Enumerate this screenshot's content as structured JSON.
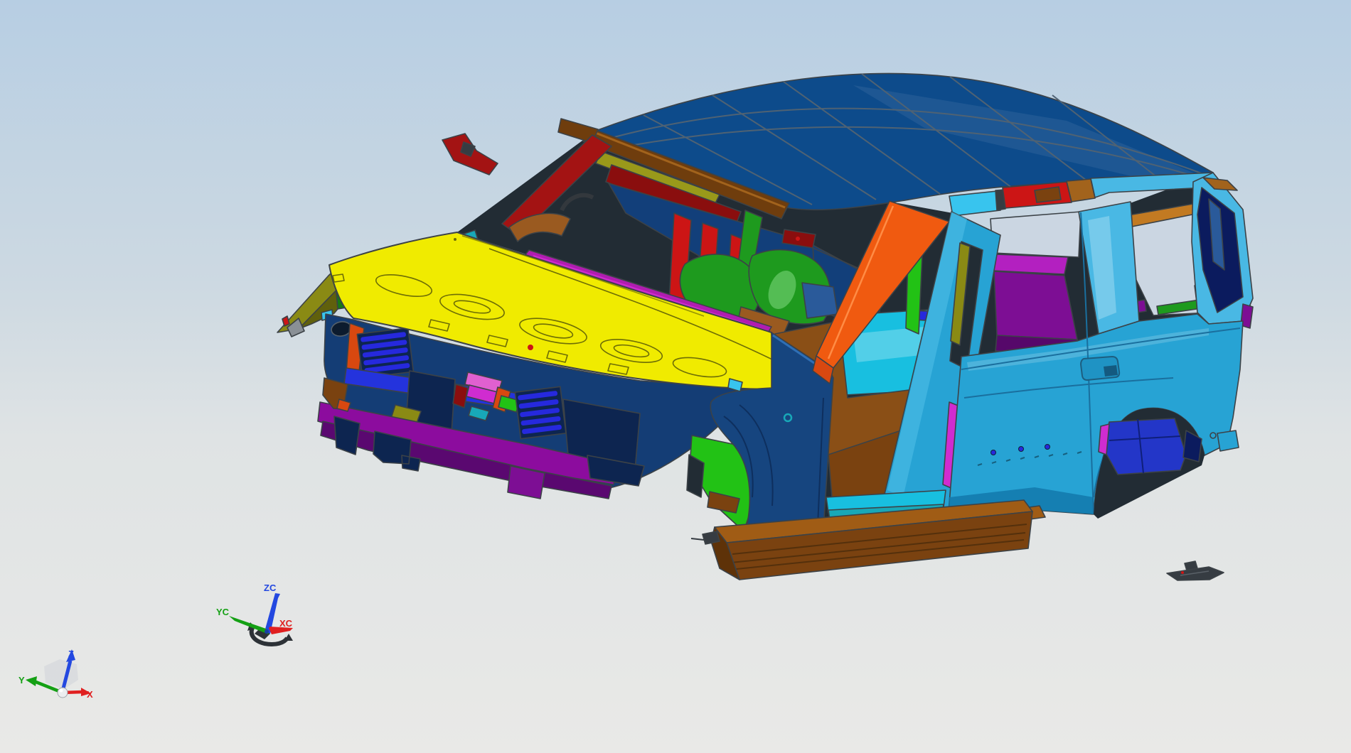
{
  "scene": {
    "type": "cad-3d-viewport",
    "content": "automotive body-in-white assembly, multi-colored sheet metal parts, isometric view"
  },
  "triads": {
    "wcs": {
      "x_label": "X",
      "y_label": "Y",
      "z_label": "Z",
      "x_color": "#e02020",
      "y_color": "#14a014",
      "z_color": "#2348e0",
      "cube_color": "#b468b4"
    },
    "csys": {
      "x_label": "XC",
      "y_label": "YC",
      "z_label": "ZC",
      "x_color": "#e02020",
      "y_color": "#14a014",
      "z_color": "#2348e0",
      "handle_color": "#2d3237"
    }
  },
  "colors": {
    "bg_top": "#b7cee3",
    "bg_mid": "#cdd9e2",
    "bg_low": "#dfe3e4",
    "bg_bottom": "#e9e9e7",
    "outline": "#3c4247",
    "interior_bg": "#222c34",
    "interior_navy": "#123f7a",
    "roof_blue": "#0d4b8b",
    "roof_seam": "#4f6273",
    "rail_brown": "#6f3d0d",
    "rail_brown_hi": "#a2631c",
    "apillar_red": "#a31313",
    "red": "#cc1515",
    "dk_red": "#8a0e0e",
    "copper": "#9a5a20",
    "hood_yellow": "#f0eb00",
    "hood_line": "#6d6d06",
    "olive": "#8a8a14",
    "olive_dark": "#60600c",
    "visor_olive": "#99991a",
    "fender_navy": "#16457f",
    "clip_navy": "#143d75",
    "navy_dark": "#0d2550",
    "grille_blue": "#2629dd",
    "blue_rail": "#2433dd",
    "steel_blue": "#2a5a9a",
    "bumper_purple": "#8c0c9e",
    "bumper_purple_dark": "#5a0870",
    "purple_rail": "#b320c0",
    "purple_panel": "#7d0e94",
    "purple_dark": "#56086a",
    "magenta": "#b01db0",
    "magenta_bright": "#d02cd0",
    "pink": "#e060d0",
    "orange": "#f05a10",
    "orange_deep": "#d84810",
    "tan_rail": "#c27a22",
    "body_blue": "#27a3d4",
    "body_blue_hi": "#55c4ea",
    "body_blue_dark": "#1379ab",
    "cpillar_blue": "#49b8e4",
    "cyan_strip": "#38c4ee",
    "cyan_floor": "#18bfe0",
    "teal": "#18a8b8",
    "bright_green": "#22c215",
    "seat_green": "#1e9a1e",
    "seat_green_dk": "#157a15",
    "floor_brown": "#8a4f16",
    "board_top": "#a05c15",
    "board_face": "#7a4210",
    "wheel_blue": "#2336c8",
    "dpillar_navy": "#0b1b5e",
    "pale_window": "#cbd6e2",
    "gray_part": "#8a9096",
    "debris_dark": "#363c42",
    "sphere": "#eceef0",
    "cube_face": "#d0d4d8"
  }
}
